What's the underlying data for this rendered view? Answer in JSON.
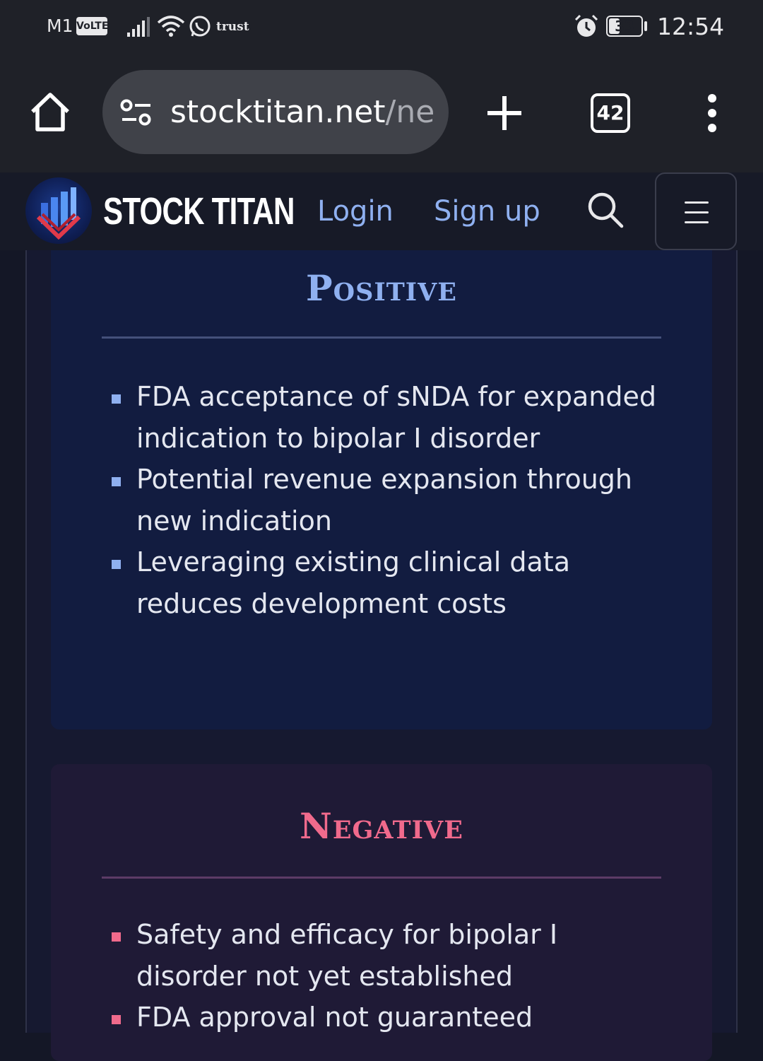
{
  "status_bar": {
    "carrier": "M1",
    "volte": "VoLTE",
    "app_label": "trust",
    "battery": "33",
    "battery_level_pct": 33,
    "time": "12:54"
  },
  "browser": {
    "url_domain": "stocktitan.net",
    "url_path": "/ne",
    "tab_count": "42"
  },
  "site_header": {
    "brand": "STOCK TITAN",
    "login": "Login",
    "signup": "Sign up"
  },
  "positive": {
    "title": "Positive",
    "items": [
      "FDA acceptance of sNDA for expanded indication to bipolar I disorder",
      "Potential revenue expansion through new indication",
      "Leveraging existing clinical data reduces development costs"
    ]
  },
  "negative": {
    "title": "Negative",
    "items": [
      "Safety and efficacy for bipolar I disorder not yet established",
      "FDA approval not guaranteed"
    ]
  },
  "colors": {
    "positive_accent": "#8fb0f0",
    "negative_accent": "#f06a8c",
    "background": "#141726"
  }
}
